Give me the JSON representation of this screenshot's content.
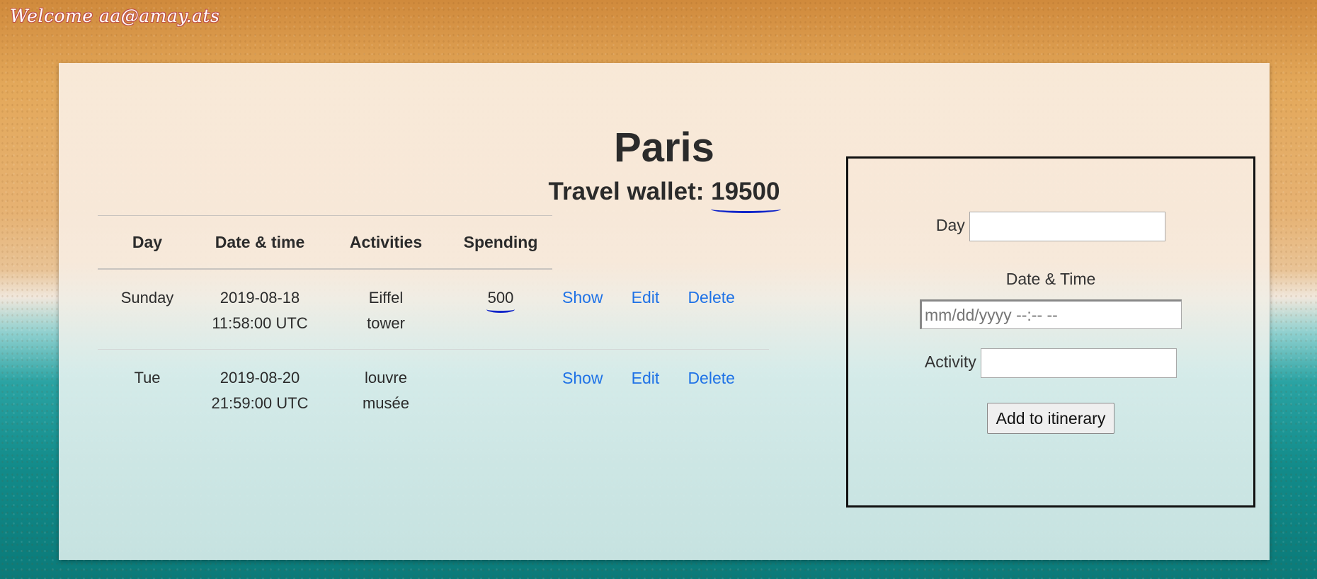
{
  "header": {
    "welcome": "Welcome aa@amay.ats"
  },
  "trip": {
    "city": "Paris",
    "wallet_label": "Travel wallet:",
    "wallet_amount": "19500"
  },
  "table": {
    "headers": [
      "Day",
      "Date & time",
      "Activities",
      "Spending"
    ],
    "rows": [
      {
        "day": "Sunday",
        "date": "2019-08-18",
        "time": "11:58:00 UTC",
        "activity_line1": "Eiffel",
        "activity_line2": "tower",
        "spending": "500",
        "show": "Show",
        "edit": "Edit",
        "delete": "Delete"
      },
      {
        "day": "Tue",
        "date": "2019-08-20",
        "time": "21:59:00 UTC",
        "activity_line1": "louvre",
        "activity_line2": "musée",
        "spending": "",
        "show": "Show",
        "edit": "Edit",
        "delete": "Delete"
      }
    ]
  },
  "form": {
    "day_label": "Day",
    "day_value": "",
    "datetime_label": "Date & Time",
    "datetime_placeholder": "mm/dd/yyyy --:-- --",
    "activity_label": "Activity",
    "activity_value": "",
    "submit_label": "Add to itinerary"
  },
  "colors": {
    "link": "#1f72e6",
    "annotation": "#1226c9"
  }
}
